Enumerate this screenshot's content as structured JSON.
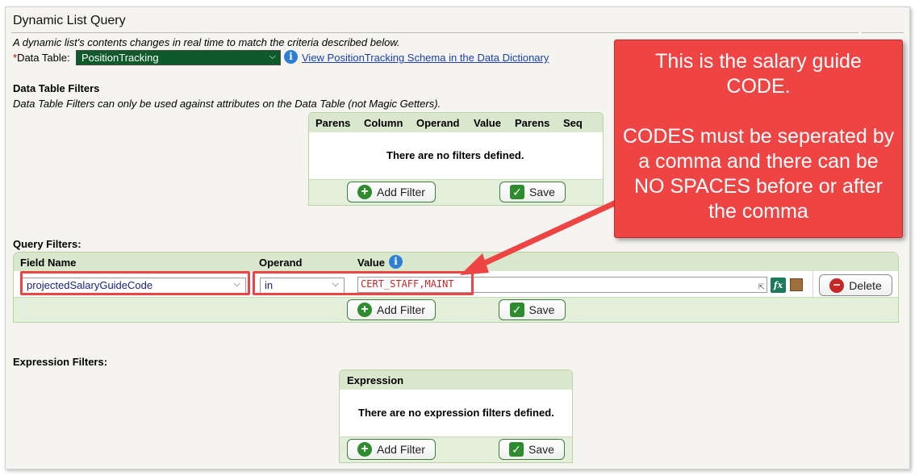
{
  "header": {
    "title": "Dynamic List Query",
    "description": "A dynamic list's contents changes in real time to match the criteria described below.",
    "data_table_label": "*Data Table:",
    "data_table_required_mark": "*",
    "data_table_label_text": "Data Table:",
    "data_table_value": "PositionTracking",
    "schema_link": "View PositionTracking Schema in the Data Dictionary"
  },
  "data_table_filters": {
    "heading": "Data Table Filters",
    "note": "Data Table Filters can only be used against attributes on the Data Table (not Magic Getters).",
    "columns": [
      "Parens",
      "Column",
      "Operand",
      "Value",
      "Parens",
      "Seq"
    ],
    "empty_message": "There are no filters defined.",
    "add_label": "Add Filter",
    "save_label": "Save"
  },
  "query_filters": {
    "heading": "Query Filters:",
    "columns": {
      "field_name": "Field Name",
      "operand": "Operand",
      "value": "Value"
    },
    "row": {
      "field_name": "projectedSalaryGuideCode",
      "operand": "in",
      "value": "CERT_STAFF,MAINT",
      "delete_label": "Delete"
    },
    "add_label": "Add Filter",
    "save_label": "Save"
  },
  "expression_filters": {
    "heading": "Expression Filters:",
    "column": "Expression",
    "empty_message": "There are no expression filters defined.",
    "add_label": "Add Filter",
    "save_label": "Save"
  },
  "annotation": {
    "line1": "This is the salary guide CODE.",
    "line2": "CODES must be seperated by a comma and there can be NO SPACES before or after the comma"
  },
  "colors": {
    "callout": "#ef4444",
    "grid_header": "#d9e8cc",
    "select_green": "#0e5a2a",
    "value_text": "#c62828"
  },
  "icons": [
    "info-icon",
    "plus-icon",
    "check-icon",
    "fx-icon",
    "box-icon",
    "minus-icon",
    "chevron-down-icon",
    "resize-handle-icon"
  ]
}
